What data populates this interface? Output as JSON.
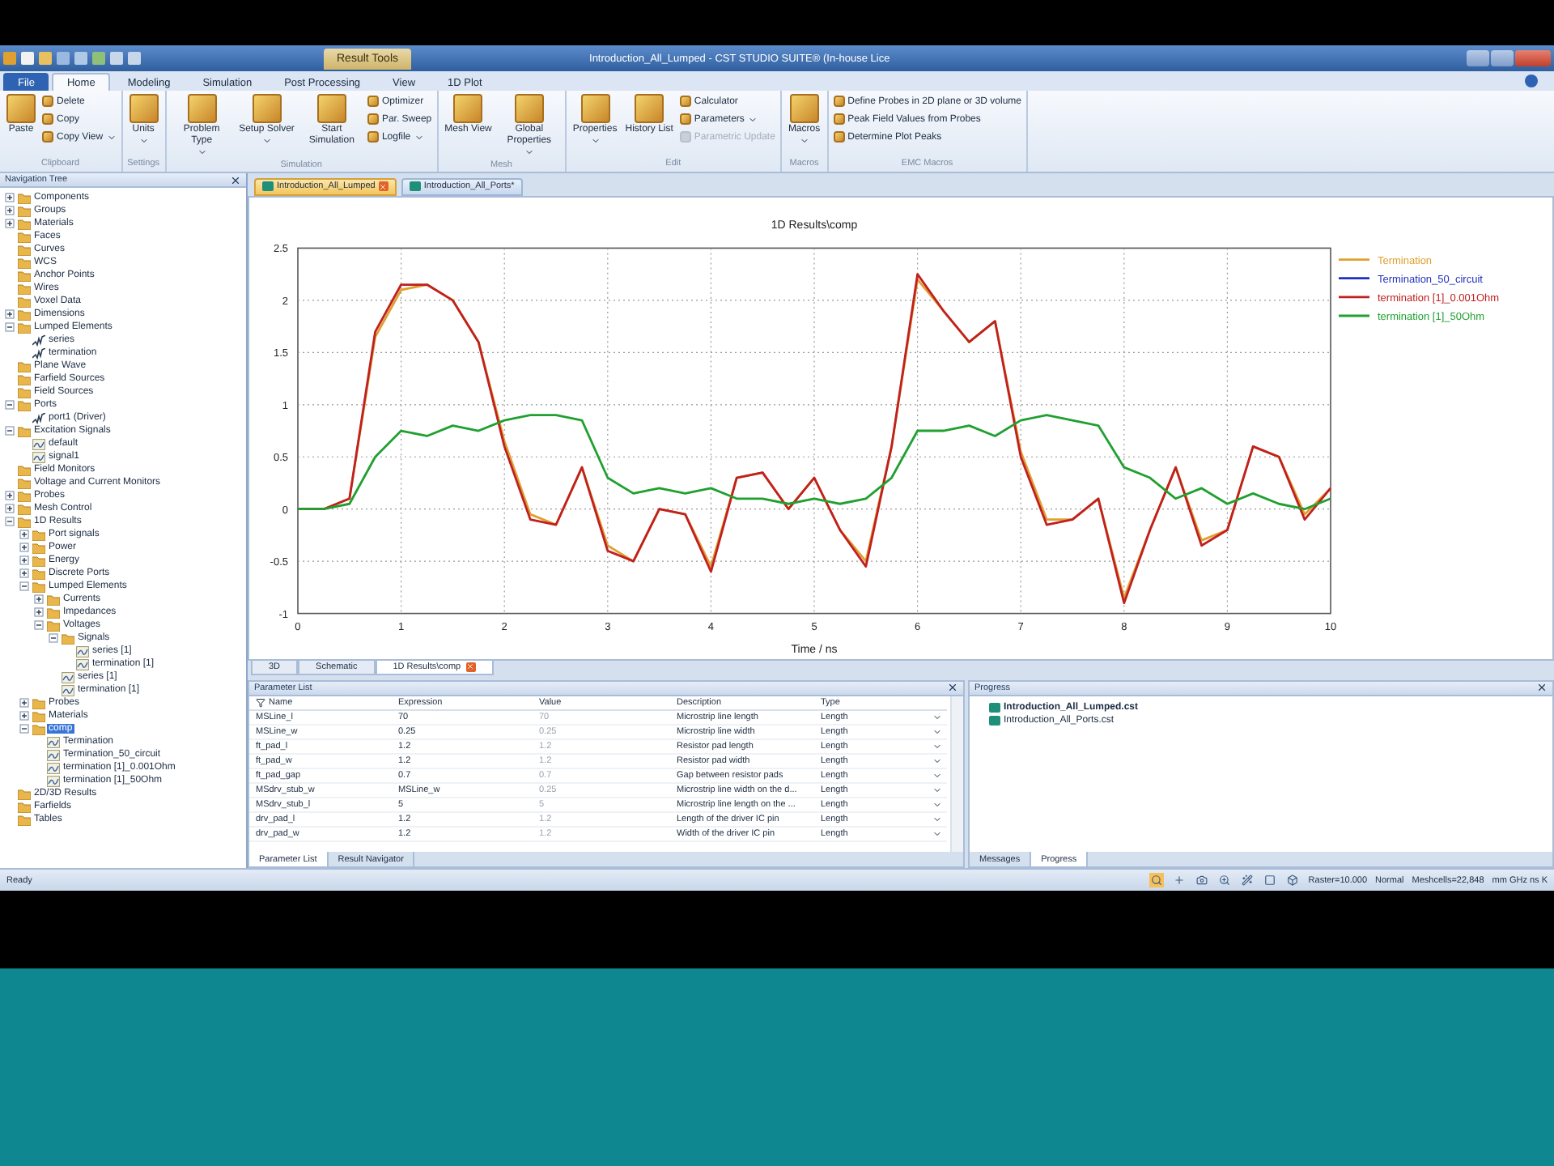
{
  "title_bar": {
    "context_tab": "Result Tools",
    "title": "Introduction_All_Lumped - CST STUDIO SUITE® (In-house Lice"
  },
  "ribbon_tabs": [
    {
      "label": "File",
      "kind": "file",
      "selected": false
    },
    {
      "label": "Home",
      "kind": "tab",
      "selected": true
    },
    {
      "label": "Modeling",
      "kind": "tab",
      "selected": false
    },
    {
      "label": "Simulation",
      "kind": "tab",
      "selected": false
    },
    {
      "label": "Post Processing",
      "kind": "tab",
      "selected": false
    },
    {
      "label": "View",
      "kind": "tab",
      "selected": false
    },
    {
      "label": "1D Plot",
      "kind": "tab",
      "selected": false
    }
  ],
  "ribbon_groups": [
    {
      "label": "Clipboard",
      "buttons": [
        {
          "label": "Paste",
          "kind": "large",
          "dropdown": false,
          "disabled": false
        },
        {
          "label": "Delete",
          "kind": "small",
          "dropdown": false,
          "disabled": false
        },
        {
          "label": "Copy",
          "kind": "small",
          "dropdown": false,
          "disabled": false
        },
        {
          "label": "Copy View",
          "kind": "small",
          "dropdown": true,
          "disabled": false
        }
      ]
    },
    {
      "label": "Settings",
      "buttons": [
        {
          "label": "Units",
          "kind": "large",
          "dropdown": true,
          "disabled": false
        }
      ]
    },
    {
      "label": "Simulation",
      "buttons": [
        {
          "label": "Problem Type",
          "kind": "large",
          "dropdown": true,
          "disabled": false
        },
        {
          "label": "Setup Solver",
          "kind": "large",
          "dropdown": true,
          "disabled": false
        },
        {
          "label": "Start Simulation",
          "kind": "large",
          "dropdown": false,
          "disabled": false
        },
        {
          "label": "Optimizer",
          "kind": "small",
          "dropdown": false,
          "disabled": false
        },
        {
          "label": "Par. Sweep",
          "kind": "small",
          "dropdown": false,
          "disabled": false
        },
        {
          "label": "Logfile",
          "kind": "small",
          "dropdown": true,
          "disabled": false
        }
      ]
    },
    {
      "label": "Mesh",
      "buttons": [
        {
          "label": "Mesh View",
          "kind": "large",
          "dropdown": false,
          "disabled": false
        },
        {
          "label": "Global Properties",
          "kind": "large",
          "dropdown": true,
          "disabled": false
        }
      ]
    },
    {
      "label": "Edit",
      "buttons": [
        {
          "label": "Properties",
          "kind": "large",
          "dropdown": true,
          "disabled": false
        },
        {
          "label": "History List",
          "kind": "large",
          "dropdown": false,
          "disabled": false
        },
        {
          "label": "Calculator",
          "kind": "small",
          "dropdown": false,
          "disabled": false
        },
        {
          "label": "Parameters",
          "kind": "small",
          "dropdown": true,
          "disabled": false
        },
        {
          "label": "Parametric Update",
          "kind": "small",
          "dropdown": false,
          "disabled": true
        }
      ]
    },
    {
      "label": "Macros",
      "buttons": [
        {
          "label": "Macros",
          "kind": "large",
          "dropdown": true,
          "disabled": false
        }
      ]
    },
    {
      "label": "EMC Macros",
      "buttons": [
        {
          "label": "Define Probes in 2D plane or 3D volume",
          "kind": "small",
          "dropdown": false,
          "disabled": false
        },
        {
          "label": "Peak Field Values from Probes",
          "kind": "small",
          "dropdown": false,
          "disabled": false
        },
        {
          "label": "Determine Plot Peaks",
          "kind": "small",
          "dropdown": false,
          "disabled": false
        }
      ]
    }
  ],
  "navigation_tree": {
    "title": "Navigation Tree",
    "items": [
      {
        "label": "Components",
        "kind": "folder",
        "expanded": false
      },
      {
        "label": "Groups",
        "kind": "folder",
        "expanded": false
      },
      {
        "label": "Materials",
        "kind": "folder",
        "expanded": false
      },
      {
        "label": "Faces",
        "kind": "folder"
      },
      {
        "label": "Curves",
        "kind": "folder"
      },
      {
        "label": "WCS",
        "kind": "folder"
      },
      {
        "label": "Anchor Points",
        "kind": "folder"
      },
      {
        "label": "Wires",
        "kind": "folder"
      },
      {
        "label": "Voxel Data",
        "kind": "folder"
      },
      {
        "label": "Dimensions",
        "kind": "folder",
        "expanded": false
      },
      {
        "label": "Lumped Elements",
        "kind": "folder",
        "expanded": true,
        "children": [
          {
            "label": "series",
            "kind": "element"
          },
          {
            "label": "termination",
            "kind": "element"
          }
        ]
      },
      {
        "label": "Plane Wave",
        "kind": "folder"
      },
      {
        "label": "Farfield Sources",
        "kind": "folder"
      },
      {
        "label": "Field Sources",
        "kind": "folder"
      },
      {
        "label": "Ports",
        "kind": "folder",
        "expanded": true,
        "children": [
          {
            "label": "port1 (Driver)",
            "kind": "element"
          }
        ]
      },
      {
        "label": "Excitation Signals",
        "kind": "folder",
        "expanded": true,
        "children": [
          {
            "label": "default",
            "kind": "signal"
          },
          {
            "label": "signal1",
            "kind": "signal"
          }
        ]
      },
      {
        "label": "Field Monitors",
        "kind": "folder"
      },
      {
        "label": "Voltage and Current Monitors",
        "kind": "folder"
      },
      {
        "label": "Probes",
        "kind": "folder",
        "expanded": false
      },
      {
        "label": "Mesh Control",
        "kind": "folder",
        "expanded": false
      },
      {
        "label": "1D Results",
        "kind": "folder",
        "expanded": true,
        "children": [
          {
            "label": "Port signals",
            "kind": "folder",
            "expanded": false
          },
          {
            "label": "Power",
            "kind": "folder",
            "expanded": false
          },
          {
            "label": "Energy",
            "kind": "folder",
            "expanded": false
          },
          {
            "label": "Discrete Ports",
            "kind": "folder",
            "expanded": false
          },
          {
            "label": "Lumped Elements",
            "kind": "folder",
            "expanded": true,
            "children": [
              {
                "label": "Currents",
                "kind": "folder",
                "expanded": false
              },
              {
                "label": "Impedances",
                "kind": "folder",
                "expanded": false
              },
              {
                "label": "Voltages",
                "kind": "folder",
                "expanded": true,
                "children": [
                  {
                    "label": "Signals",
                    "kind": "folder",
                    "expanded": true,
                    "children": [
                      {
                        "label": "series [1]",
                        "kind": "signal"
                      },
                      {
                        "label": "termination [1]",
                        "kind": "signal"
                      }
                    ]
                  },
                  {
                    "label": "series [1]",
                    "kind": "signal"
                  },
                  {
                    "label": "termination [1]",
                    "kind": "signal"
                  }
                ]
              }
            ]
          },
          {
            "label": "Probes",
            "kind": "folder",
            "expanded": false
          },
          {
            "label": "Materials",
            "kind": "folder",
            "expanded": false
          },
          {
            "label": "comp",
            "kind": "folder",
            "expanded": true,
            "selected": true,
            "children": [
              {
                "label": "Termination",
                "kind": "signal"
              },
              {
                "label": "Termination_50_circuit",
                "kind": "signal"
              },
              {
                "label": "termination [1]_0.001Ohm",
                "kind": "signal"
              },
              {
                "label": "termination [1]_50Ohm",
                "kind": "signal"
              }
            ]
          }
        ]
      },
      {
        "label": "2D/3D Results",
        "kind": "folder"
      },
      {
        "label": "Farfields",
        "kind": "folder"
      },
      {
        "label": "Tables",
        "kind": "folder"
      }
    ]
  },
  "document_tabs": [
    {
      "label": "Introduction_All_Lumped",
      "selected": true
    },
    {
      "label": "Introduction_All_Ports*",
      "selected": false
    }
  ],
  "chart": {
    "chart_data": {
      "type": "line",
      "title": "1D Results\\comp",
      "xlabel": "Time / ns",
      "xlim": [
        0,
        10
      ],
      "ylim": [
        -1,
        2.5
      ],
      "grid": true,
      "legend": "right",
      "xticks": [
        0,
        1,
        2,
        3,
        4,
        5,
        6,
        7,
        8,
        9,
        10
      ],
      "yticks": [
        -1,
        -0.5,
        0,
        0.5,
        1,
        1.5,
        2,
        2.5
      ],
      "x": [
        0,
        0.25,
        0.5,
        0.75,
        1,
        1.25,
        1.5,
        1.75,
        2,
        2.25,
        2.5,
        2.75,
        3,
        3.25,
        3.5,
        3.75,
        4,
        4.25,
        4.5,
        4.75,
        5,
        5.25,
        5.5,
        5.75,
        6,
        6.25,
        6.5,
        6.75,
        7,
        7.25,
        7.5,
        7.75,
        8,
        8.25,
        8.5,
        8.75,
        9,
        9.25,
        9.5,
        9.75,
        10
      ],
      "series": [
        {
          "name": "Termination",
          "color": "#e0a030",
          "values": [
            0,
            0,
            0.1,
            1.65,
            2.1,
            2.15,
            2.0,
            1.6,
            0.65,
            -0.05,
            -0.15,
            0.4,
            -0.35,
            -0.5,
            0.0,
            -0.05,
            -0.55,
            0.3,
            0.35,
            0.0,
            0.3,
            -0.2,
            -0.5,
            0.6,
            2.2,
            1.9,
            1.6,
            1.8,
            0.55,
            -0.1,
            -0.1,
            0.1,
            -0.85,
            -0.2,
            0.4,
            -0.3,
            -0.2,
            0.6,
            0.5,
            -0.05,
            0.2
          ]
        },
        {
          "name": "Termination_50_circuit",
          "color": "#2030c0",
          "values": [
            null,
            null,
            null,
            null,
            null,
            null,
            null,
            null,
            null,
            null,
            null,
            null,
            null,
            null,
            null,
            null,
            null,
            null,
            null,
            null,
            null,
            null,
            null,
            null,
            null,
            null,
            null,
            null,
            null,
            null,
            null,
            null,
            null,
            null,
            null,
            null,
            null,
            null,
            null,
            null,
            null
          ]
        },
        {
          "name": "termination [1]_0.001Ohm",
          "color": "#c02020",
          "values": [
            0,
            0,
            0.1,
            1.7,
            2.15,
            2.15,
            2.0,
            1.6,
            0.6,
            -0.1,
            -0.15,
            0.4,
            -0.4,
            -0.5,
            0.0,
            -0.05,
            -0.6,
            0.3,
            0.35,
            0.0,
            0.3,
            -0.2,
            -0.55,
            0.6,
            2.25,
            1.9,
            1.6,
            1.8,
            0.5,
            -0.15,
            -0.1,
            0.1,
            -0.9,
            -0.2,
            0.4,
            -0.35,
            -0.2,
            0.6,
            0.5,
            -0.1,
            0.2
          ]
        },
        {
          "name": "termination [1]_50Ohm",
          "color": "#20a030",
          "values": [
            0,
            0,
            0.05,
            0.5,
            0.75,
            0.7,
            0.8,
            0.75,
            0.85,
            0.9,
            0.9,
            0.85,
            0.3,
            0.15,
            0.2,
            0.15,
            0.2,
            0.1,
            0.1,
            0.05,
            0.1,
            0.05,
            0.1,
            0.3,
            0.75,
            0.75,
            0.8,
            0.7,
            0.85,
            0.9,
            0.85,
            0.8,
            0.4,
            0.3,
            0.1,
            0.2,
            0.05,
            0.15,
            0.05,
            0,
            0.1
          ]
        }
      ]
    }
  },
  "view_tabs": [
    {
      "label": "3D",
      "selected": false
    },
    {
      "label": "Schematic",
      "selected": false
    },
    {
      "label": "1D Results\\comp",
      "selected": true
    }
  ],
  "parameter_list": {
    "title": "Parameter List",
    "columns": [
      "Name",
      "Expression",
      "Value",
      "Description",
      "Type"
    ],
    "rows": [
      [
        "MSLine_l",
        "70",
        "70",
        "Microstrip line length",
        "Length"
      ],
      [
        "MSLine_w",
        "0.25",
        "0.25",
        "Microstrip line width",
        "Length"
      ],
      [
        "ft_pad_l",
        "1.2",
        "1.2",
        "Resistor pad length",
        "Length"
      ],
      [
        "ft_pad_w",
        "1.2",
        "1.2",
        "Resistor pad width",
        "Length"
      ],
      [
        "ft_pad_gap",
        "0.7",
        "0.7",
        "Gap between resistor pads",
        "Length"
      ],
      [
        "MSdrv_stub_w",
        "MSLine_w",
        "0.25",
        "Microstrip line width on the d...",
        "Length"
      ],
      [
        "MSdrv_stub_l",
        "5",
        "5",
        "Microstrip line length on the ...",
        "Length"
      ],
      [
        "drv_pad_l",
        "1.2",
        "1.2",
        "Length of the driver IC pin",
        "Length"
      ],
      [
        "drv_pad_w",
        "1.2",
        "1.2",
        "Width of the driver IC pin",
        "Length"
      ]
    ],
    "tabs": [
      {
        "label": "Parameter List",
        "selected": true
      },
      {
        "label": "Result Navigator",
        "selected": false
      }
    ]
  },
  "progress": {
    "title": "Progress",
    "files": [
      {
        "label": "Introduction_All_Lumped.cst",
        "active": true
      },
      {
        "label": "Introduction_All_Ports.cst",
        "active": false
      }
    ],
    "tabs": [
      {
        "label": "Messages",
        "selected": false
      },
      {
        "label": "Progress",
        "selected": true
      }
    ]
  },
  "status_bar": {
    "status": "Ready",
    "fields": [
      "Raster=10.000",
      "Normal",
      "Meshcells=22,848",
      "mm GHz ns K"
    ]
  }
}
